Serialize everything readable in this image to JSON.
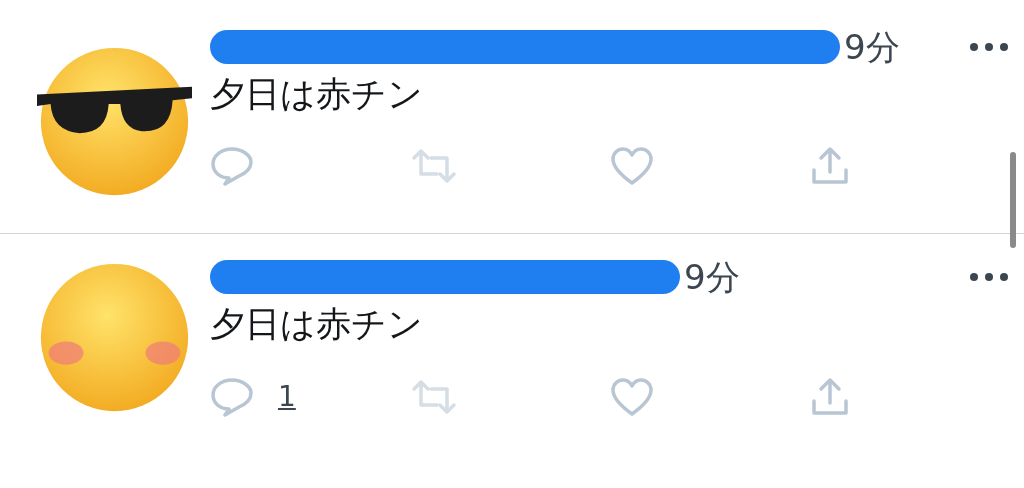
{
  "tweets": [
    {
      "avatar": {
        "kind": "sunglasses"
      },
      "name_redacted": true,
      "time": "9分",
      "text": "夕日は赤チン"
    },
    {
      "avatar": {
        "kind": "blushing"
      },
      "name_redacted": true,
      "time": "9分",
      "text": "夕日は赤チン",
      "reply_count": "1"
    }
  ]
}
